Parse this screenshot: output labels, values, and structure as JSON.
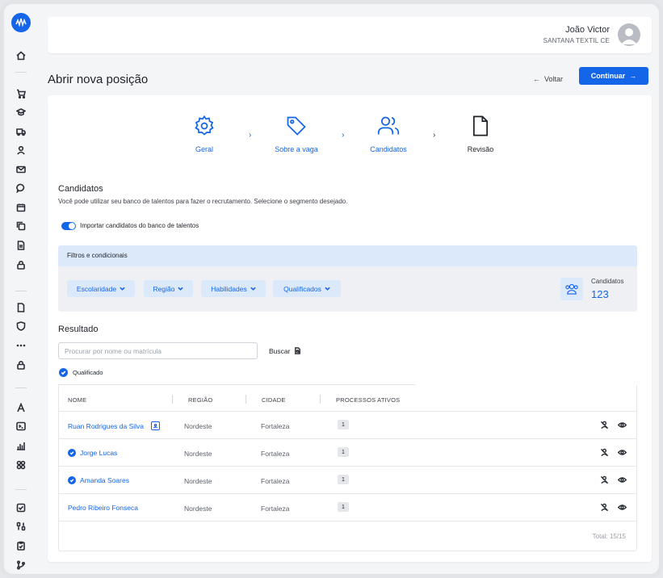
{
  "user": {
    "name": "João Victor",
    "company": "SANTANA TEXTIL CE"
  },
  "page": {
    "title": "Abrir nova posição",
    "back_label": "Voltar",
    "continue_label": "Continuar"
  },
  "steps": [
    {
      "label": "Geral",
      "icon": "gear-icon"
    },
    {
      "label": "Sobre a vaga",
      "icon": "tag-icon"
    },
    {
      "label": "Candidatos",
      "icon": "users-icon"
    },
    {
      "label": "Revisão",
      "icon": "document-icon"
    }
  ],
  "candidates_section": {
    "title": "Candidatos",
    "description": "Você pode utilizar seu banco de talentos para fazer o recrutamento. Selecione o segmento desejado.",
    "toggle_label": "Importar candidatos do banco de talentos",
    "toggle_on": true
  },
  "filters": {
    "title": "Filtros e condicionais",
    "chips": [
      "Escolaridade",
      "Região",
      "Habilidades",
      "Qualificados"
    ],
    "count_label": "Candidatos",
    "count_value": "123"
  },
  "results": {
    "title": "Resultado",
    "search_placeholder": "Procurar por nome ou matrícula",
    "search_button": "Buscar",
    "qualified_label": "Qualificado",
    "columns": [
      "NOME",
      "REGIÃO",
      "CIDADE",
      "PROCESSOS ATIVOS"
    ],
    "rows": [
      {
        "name": "Ruan Rodrigues da Silva",
        "region": "Nordeste",
        "city": "Fortaleza",
        "active": "1",
        "qualified": false,
        "ai_badge": true
      },
      {
        "name": "Jorge Lucas",
        "region": "Nordeste",
        "city": "Fortaleza",
        "active": "1",
        "qualified": true,
        "ai_badge": false
      },
      {
        "name": "Amanda Soares",
        "region": "Nordeste",
        "city": "Fortaleza",
        "active": "1",
        "qualified": true,
        "ai_badge": false
      },
      {
        "name": "Pedro Ribeiro Fonseca",
        "region": "Nordeste",
        "city": "Fortaleza",
        "active": "1",
        "qualified": false,
        "ai_badge": false
      }
    ],
    "total": "Total: 15/15"
  },
  "colors": {
    "primary": "#1565e8",
    "filter_head": "#dce9fb",
    "filter_body": "#eef0f3"
  }
}
